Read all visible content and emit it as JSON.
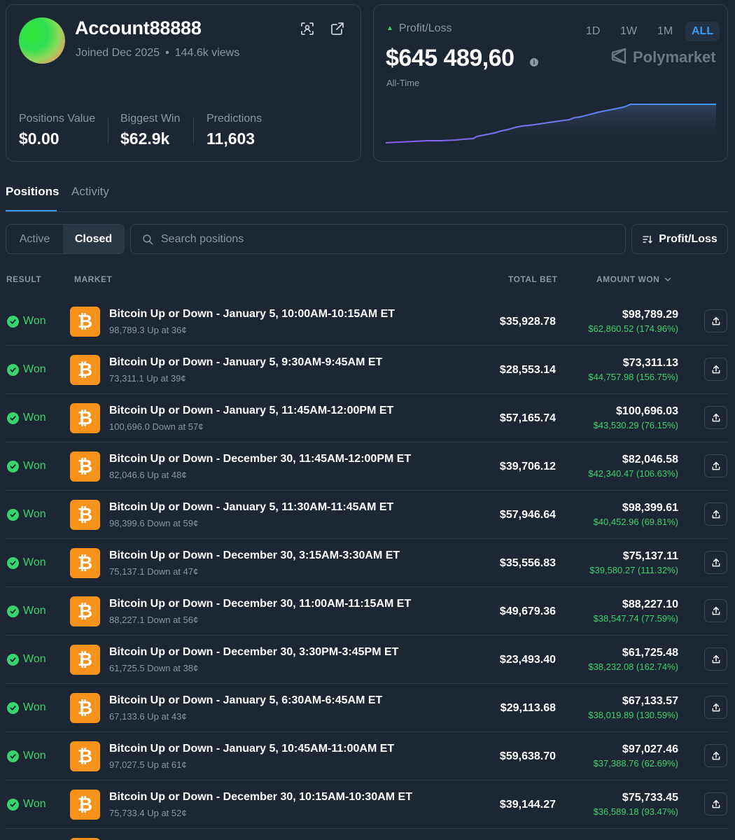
{
  "profile": {
    "username": "Account88888",
    "joined": "Joined Dec 2025",
    "views": "144.6k views",
    "stats": [
      {
        "label": "Positions Value",
        "value": "$0.00"
      },
      {
        "label": "Biggest Win",
        "value": "$62.9k"
      },
      {
        "label": "Predictions",
        "value": "11,603"
      }
    ]
  },
  "pnl": {
    "label": "Profit/Loss",
    "value": "$645 489,60",
    "period": "All-Time",
    "ranges": [
      "1D",
      "1W",
      "1M",
      "ALL"
    ],
    "active_range": "ALL",
    "brand": "Polymarket",
    "line_color": "#7a6cf0",
    "accent": "#3b9cf2"
  },
  "tabs": {
    "positions": "Positions",
    "activity": "Activity"
  },
  "filters": {
    "active": "Active",
    "closed": "Closed",
    "search_placeholder": "Search positions",
    "sort_label": "Profit/Loss"
  },
  "table": {
    "headers": {
      "result": "RESULT",
      "market": "MARKET",
      "total_bet": "TOTAL BET",
      "amount_won": "AMOUNT WON"
    },
    "rows": [
      {
        "result": "Won",
        "title": "Bitcoin Up or Down - January 5, 10:00AM-10:15AM ET",
        "sub": "98,789.3 Up at 36¢",
        "bet": "$35,928.78",
        "won": "$98,789.29",
        "gain": "$62,860.52 (174.96%)"
      },
      {
        "result": "Won",
        "title": "Bitcoin Up or Down - January 5, 9:30AM-9:45AM ET",
        "sub": "73,311.1 Up at 39¢",
        "bet": "$28,553.14",
        "won": "$73,311.13",
        "gain": "$44,757.98 (156.75%)"
      },
      {
        "result": "Won",
        "title": "Bitcoin Up or Down - January 5, 11:45AM-12:00PM ET",
        "sub": "100,696.0 Down at 57¢",
        "bet": "$57,165.74",
        "won": "$100,696.03",
        "gain": "$43,530.29 (76.15%)"
      },
      {
        "result": "Won",
        "title": "Bitcoin Up or Down - December 30, 11:45AM-12:00PM ET",
        "sub": "82,046.6 Up at 48¢",
        "bet": "$39,706.12",
        "won": "$82,046.58",
        "gain": "$42,340.47 (106.63%)"
      },
      {
        "result": "Won",
        "title": "Bitcoin Up or Down - January 5, 11:30AM-11:45AM ET",
        "sub": "98,399.6 Down at 59¢",
        "bet": "$57,946.64",
        "won": "$98,399.61",
        "gain": "$40,452.96 (69.81%)"
      },
      {
        "result": "Won",
        "title": "Bitcoin Up or Down - December 30, 3:15AM-3:30AM ET",
        "sub": "75,137.1 Down at 47¢",
        "bet": "$35,556.83",
        "won": "$75,137.11",
        "gain": "$39,580.27 (111.32%)"
      },
      {
        "result": "Won",
        "title": "Bitcoin Up or Down - December 30, 11:00AM-11:15AM ET",
        "sub": "88,227.1 Down at 56¢",
        "bet": "$49,679.36",
        "won": "$88,227.10",
        "gain": "$38,547.74 (77.59%)"
      },
      {
        "result": "Won",
        "title": "Bitcoin Up or Down - December 30, 3:30PM-3:45PM ET",
        "sub": "61,725.5 Down at 38¢",
        "bet": "$23,493.40",
        "won": "$61,725.48",
        "gain": "$38,232.08 (162.74%)"
      },
      {
        "result": "Won",
        "title": "Bitcoin Up or Down - January 5, 6:30AM-6:45AM ET",
        "sub": "67,133.6 Up at 43¢",
        "bet": "$29,113.68",
        "won": "$67,133.57",
        "gain": "$38,019.89 (130.59%)"
      },
      {
        "result": "Won",
        "title": "Bitcoin Up or Down - January 5, 10:45AM-11:00AM ET",
        "sub": "97,027.5 Up at 61¢",
        "bet": "$59,638.70",
        "won": "$97,027.46",
        "gain": "$37,388.76 (62.69%)"
      },
      {
        "result": "Won",
        "title": "Bitcoin Up or Down - December 30, 10:15AM-10:30AM ET",
        "sub": "75,733.4 Up at 52¢",
        "bet": "$39,144.27",
        "won": "$75,733.45",
        "gain": "$36,589.18 (93.47%)"
      }
    ]
  }
}
